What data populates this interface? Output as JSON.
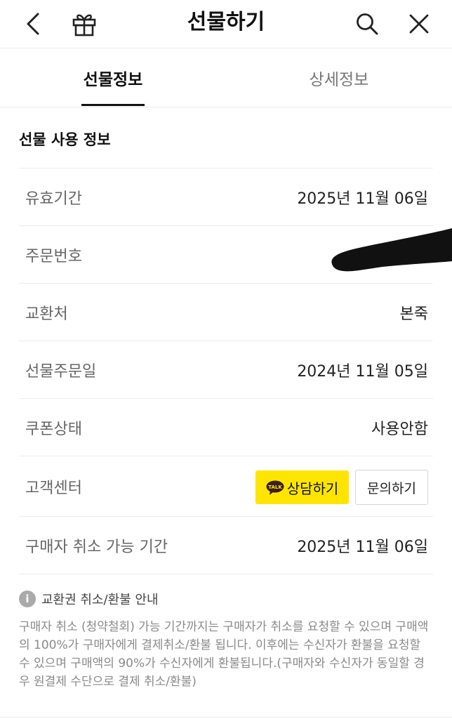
{
  "header": {
    "title": "선물하기",
    "back_icon": "chevron-left-icon",
    "gift_icon": "gift-icon",
    "search_icon": "search-icon",
    "close_icon": "close-icon"
  },
  "tabs": [
    {
      "label": "선물정보",
      "active": true
    },
    {
      "label": "상세정보",
      "active": false
    }
  ],
  "section_title": "선물 사용 정보",
  "rows": {
    "expiry": {
      "label": "유효기간",
      "value": "2025년 11월 06일"
    },
    "order_no": {
      "label": "주문번호",
      "value": ""
    },
    "exchange": {
      "label": "교환처",
      "value": "본죽"
    },
    "order_date": {
      "label": "선물주문일",
      "value": "2024년 11월 05일"
    },
    "coupon_status": {
      "label": "쿠폰상태",
      "value": "사용안함"
    },
    "customer_center": {
      "label": "고객센터",
      "chat_button": "상담하기",
      "chat_badge": "TALK",
      "inquiry_button": "문의하기"
    },
    "cancel_period": {
      "label": "구매자 취소 가능 기간",
      "value": "2025년 11월 06일"
    }
  },
  "notice": {
    "title": "교환권 취소/환불 안내",
    "body": "구매자 취소 (청약철회) 가능 기간까지는 구매자가 취소를 요청할 수 있으며 구매액의 100%가 구매자에게 결제취소/환불 됩니다. 이후에는 수신자가 환불을 요청할 수 있으며 구매액의 90%가 수신자에게 환불됩니다.(구매자와 수신자가 동일할 경우 원결제 수단으로 결제 취소/환불)"
  },
  "colors": {
    "kakao_yellow": "#FEE500",
    "divider": "#ececec"
  }
}
